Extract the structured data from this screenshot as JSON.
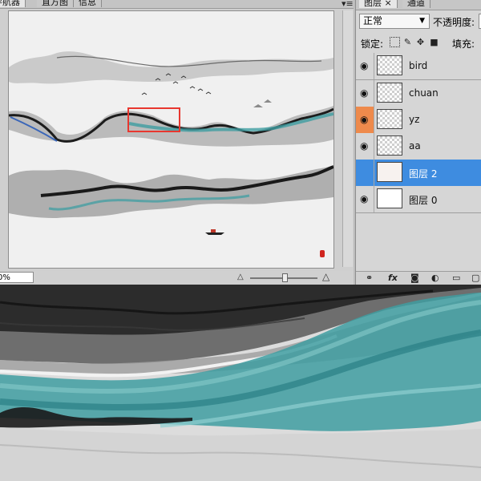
{
  "navigator": {
    "tabs": [
      "导航器",
      "直方图",
      "信息"
    ],
    "menu_icon": "▾≡",
    "zoom_value": "0%",
    "zoom_out_icon": "△",
    "zoom_in_icon": "△"
  },
  "layers_panel": {
    "tabs": [
      "图层 ×",
      "通道"
    ],
    "blend_mode": "正常",
    "opacity_label": "不透明度:",
    "lock_label": "锁定:",
    "fill_label": "填充:",
    "selected_layer": "图层 2",
    "eye_icon": "◉",
    "layers": [
      {
        "name": "bird",
        "thumbnail": "transparent"
      },
      {
        "name": "chuan",
        "thumbnail": "transparent"
      },
      {
        "name": "yz",
        "thumbnail": "transparent"
      },
      {
        "name": "aa",
        "thumbnail": "transparent"
      },
      {
        "name": "图层 2",
        "thumbnail": "cream"
      },
      {
        "name": "图层 0",
        "thumbnail": "white"
      }
    ],
    "footer_icons": [
      "link-icon",
      "fx-icon",
      "mask-icon",
      "adjustment-icon",
      "group-icon",
      "new-layer-icon"
    ]
  },
  "colors": {
    "selected_row": "#3e8ce0",
    "eye_highlight": "#ee8a4c",
    "view_box": "#e8372f",
    "teal_ink": "#3f9ea1",
    "seal_red": "#d0251f"
  }
}
